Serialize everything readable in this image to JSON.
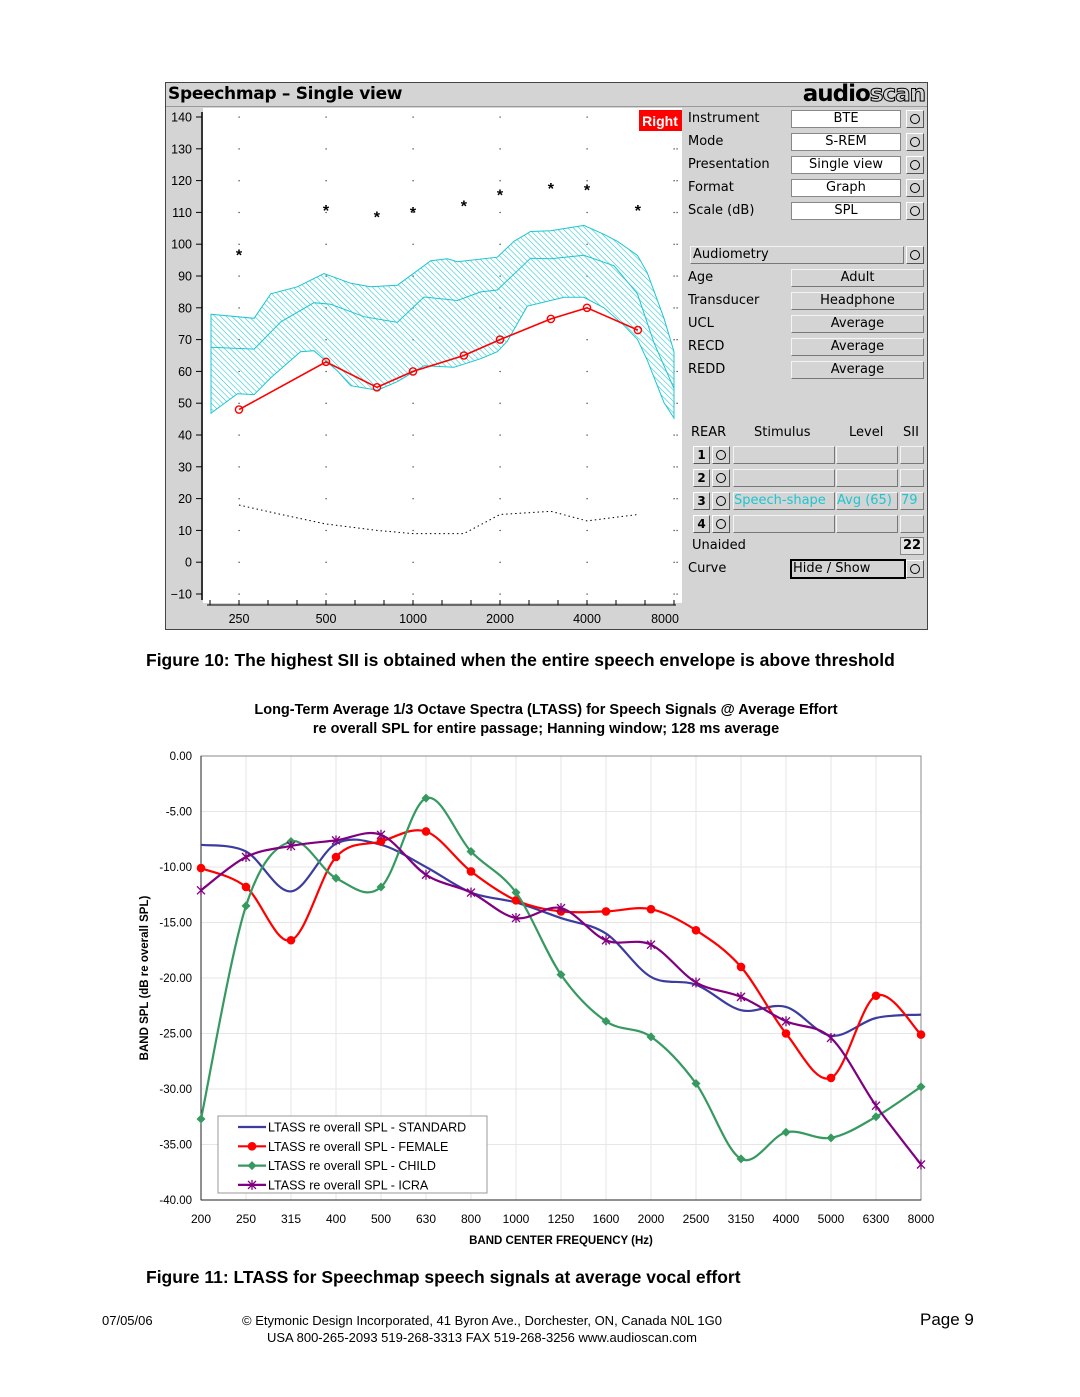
{
  "speechmap": {
    "title": "Speechmap – Single view",
    "logo": {
      "part1": "audio",
      "part2": "scan"
    },
    "ear_badge": "Right",
    "settings": [
      {
        "label": "Instrument",
        "value": "BTE"
      },
      {
        "label": "Mode",
        "value": "S-REM"
      },
      {
        "label": "Presentation",
        "value": "Single view"
      },
      {
        "label": "Format",
        "value": "Graph"
      },
      {
        "label": "Scale (dB)",
        "value": "SPL"
      }
    ],
    "audiometry_label": "Audiometry",
    "audiometry": [
      {
        "label": "Age",
        "value": "Adult"
      },
      {
        "label": "Transducer",
        "value": "Headphone"
      },
      {
        "label": "UCL",
        "value": "Average"
      },
      {
        "label": "RECD",
        "value": "Average"
      },
      {
        "label": "REDD",
        "value": "Average"
      }
    ],
    "rear_header": {
      "rear": "REAR",
      "stimulus": "Stimulus",
      "level": "Level",
      "sii": "SII"
    },
    "rear_rows": [
      {
        "num": "1",
        "stimulus": "",
        "level": "",
        "sii": ""
      },
      {
        "num": "2",
        "stimulus": "",
        "level": "",
        "sii": ""
      },
      {
        "num": "3",
        "stimulus": "Speech-shape",
        "level": "Avg (65)",
        "sii": "79"
      },
      {
        "num": "4",
        "stimulus": "",
        "level": "",
        "sii": ""
      }
    ],
    "unaided": {
      "label": "Unaided",
      "value": "22"
    },
    "curve": {
      "label": "Curve",
      "value": "Hide / Show"
    },
    "colors": {
      "aided": "#ff0000",
      "envelope": "#1cc6d0",
      "badge": "#ff0000"
    }
  },
  "figure10_caption": "Figure 10: The highest SII is obtained when the entire speech envelope is above threshold",
  "ltass_chart": {
    "title_line1": "Long-Term Average 1/3 Octave Spectra (LTASS) for Speech Signals @ Average Effort",
    "title_line2": "re overall SPL for entire passage; Hanning window; 128 ms average"
  },
  "figure11_caption": "Figure 11:  LTASS for Speechmap speech signals at average vocal effort",
  "footer": {
    "date": "07/05/06",
    "line1": "© Etymonic Design Incorporated, 41 Byron Ave., Dorchester, ON, Canada  N0L 1G0",
    "line2": "USA 800-265-2093  519-268-3313  FAX 519-268-3256  www.audioscan.com",
    "page": "Page 9"
  },
  "chart_data": [
    {
      "type": "line",
      "xscale": "log",
      "xticks": [
        250,
        500,
        1000,
        2000,
        4000,
        8000
      ],
      "yticks": [
        140,
        130,
        120,
        110,
        100,
        90,
        80,
        70,
        60,
        50,
        40,
        30,
        20,
        10,
        0,
        -10
      ],
      "ylim": [
        -10,
        140
      ],
      "xlim": [
        200,
        8000
      ],
      "grid": "dotted",
      "ucl_asterisks": [
        [
          250,
          97
        ],
        [
          500,
          111
        ],
        [
          750,
          109
        ],
        [
          1000,
          110.5
        ],
        [
          1500,
          112.5
        ],
        [
          2000,
          116
        ],
        [
          3000,
          118
        ],
        [
          4000,
          117.5
        ],
        [
          6000,
          111
        ]
      ],
      "aided_rear3": [
        [
          250,
          48
        ],
        [
          500,
          63
        ],
        [
          750,
          55
        ],
        [
          1000,
          60
        ],
        [
          1500,
          65
        ],
        [
          2000,
          70
        ],
        [
          3000,
          76.5
        ],
        [
          4000,
          80
        ],
        [
          6000,
          73
        ]
      ],
      "threshold_dotted": [
        [
          250,
          18
        ],
        [
          350,
          15
        ],
        [
          500,
          12
        ],
        [
          750,
          10
        ],
        [
          1000,
          9
        ],
        [
          1500,
          9
        ],
        [
          2000,
          15
        ],
        [
          3000,
          16
        ],
        [
          4000,
          13
        ],
        [
          6000,
          15
        ]
      ],
      "envelope_upper": [
        [
          200,
          78
        ],
        [
          282,
          76.7
        ],
        [
          322,
          84.4
        ],
        [
          398,
          86.6
        ],
        [
          492,
          90.8
        ],
        [
          609,
          87.7
        ],
        [
          713,
          86.6
        ],
        [
          883,
          87.1
        ],
        [
          1152,
          94.8
        ],
        [
          1315,
          95.4
        ],
        [
          1424,
          94.5
        ],
        [
          1958,
          95.9
        ],
        [
          2236,
          100.9
        ],
        [
          2552,
          104
        ],
        [
          2994,
          104.2
        ],
        [
          3902,
          105.9
        ],
        [
          4578,
          103.1
        ],
        [
          5096,
          100.9
        ],
        [
          5976,
          96.5
        ],
        [
          6468,
          91
        ],
        [
          7386,
          76.7
        ],
        [
          8000,
          66.2
        ]
      ],
      "envelope_lower": [
        [
          200,
          46.9
        ],
        [
          247,
          53
        ],
        [
          282,
          52.7
        ],
        [
          322,
          58
        ],
        [
          408,
          66.2
        ],
        [
          454,
          66.5
        ],
        [
          547,
          60.2
        ],
        [
          609,
          55.5
        ],
        [
          753,
          54.1
        ],
        [
          883,
          56.8
        ],
        [
          1092,
          61.8
        ],
        [
          1386,
          61.3
        ],
        [
          1715,
          64
        ],
        [
          1958,
          66.2
        ],
        [
          2120,
          69.5
        ],
        [
          2486,
          80.5
        ],
        [
          3331,
          83.3
        ],
        [
          3902,
          83.3
        ],
        [
          4578,
          80
        ],
        [
          5369,
          74.5
        ],
        [
          5976,
          70.1
        ],
        [
          6468,
          63.5
        ],
        [
          7386,
          50.2
        ],
        [
          8000,
          45.3
        ]
      ],
      "envelope_ltass": [
        [
          200,
          67.6
        ],
        [
          282,
          67
        ],
        [
          349,
          75.6
        ],
        [
          454,
          81.6
        ],
        [
          519,
          81.1
        ],
        [
          677,
          77.2
        ],
        [
          883,
          75.4
        ],
        [
          1092,
          83.4
        ],
        [
          1424,
          82.3
        ],
        [
          1715,
          85
        ],
        [
          1958,
          85.6
        ],
        [
          2552,
          95.6
        ],
        [
          2994,
          95.4
        ],
        [
          3902,
          96.5
        ],
        [
          4962,
          93.2
        ],
        [
          5976,
          84.4
        ],
        [
          6823,
          69
        ],
        [
          8000,
          54.6
        ]
      ]
    },
    {
      "type": "line",
      "title": "Long-Term Average 1/3 Octave Spectra (LTASS) for Speech Signals @ Average Effort",
      "subtitle": "re overall SPL for entire passage; Hanning window; 128 ms average",
      "xlabel": "BAND CENTER FREQUENCY (Hz)",
      "ylabel": "BAND SPL (dB re overall SPL)",
      "categories": [
        "200",
        "250",
        "315",
        "400",
        "500",
        "630",
        "800",
        "1000",
        "1250",
        "1600",
        "2000",
        "2500",
        "3150",
        "4000",
        "5000",
        "6300",
        "8000"
      ],
      "yticks": [
        "0.00",
        "-5.00",
        "-10.00",
        "-15.00",
        "-20.00",
        "-25.00",
        "-30.00",
        "-35.00",
        "-40.00"
      ],
      "ylim": [
        -40,
        0
      ],
      "grid": true,
      "legend": "bottom-left",
      "series": [
        {
          "name": "LTASS re overall SPL - STANDARD",
          "color": "#3c3ca0",
          "marker": "none",
          "values": [
            -8.0,
            -8.6,
            -12.2,
            -7.9,
            -8.0,
            -10.0,
            -12.3,
            -13.2,
            -14.6,
            -16.0,
            -19.9,
            -20.6,
            -22.9,
            -22.6,
            -25.2,
            -23.6,
            -23.3
          ]
        },
        {
          "name": "LTASS re overall SPL - FEMALE",
          "color": "#ff0000",
          "marker": "circle",
          "values": [
            -10.1,
            -11.8,
            -16.6,
            -9.1,
            -7.7,
            -6.8,
            -10.4,
            -13.0,
            -14.0,
            -14.0,
            -13.8,
            -15.7,
            -19.0,
            -25.0,
            -29.0,
            -21.6,
            -25.1
          ]
        },
        {
          "name": "LTASS re overall SPL - CHILD",
          "color": "#36995f",
          "marker": "diamond",
          "values": [
            -32.7,
            -13.5,
            -7.7,
            -11.0,
            -11.8,
            -3.8,
            -8.6,
            -12.3,
            -19.7,
            -23.9,
            -25.3,
            -29.5,
            -36.3,
            -33.9,
            -34.4,
            -32.5,
            -29.8
          ]
        },
        {
          "name": "LTASS re overall SPL - ICRA",
          "color": "#800080",
          "marker": "asterisk",
          "values": [
            -12.1,
            -9.1,
            -8.1,
            -7.6,
            -7.1,
            -10.7,
            -12.3,
            -14.6,
            -13.7,
            -16.6,
            -17.0,
            -20.4,
            -21.7,
            -23.9,
            -25.4,
            -31.5,
            -36.8
          ]
        }
      ]
    }
  ]
}
